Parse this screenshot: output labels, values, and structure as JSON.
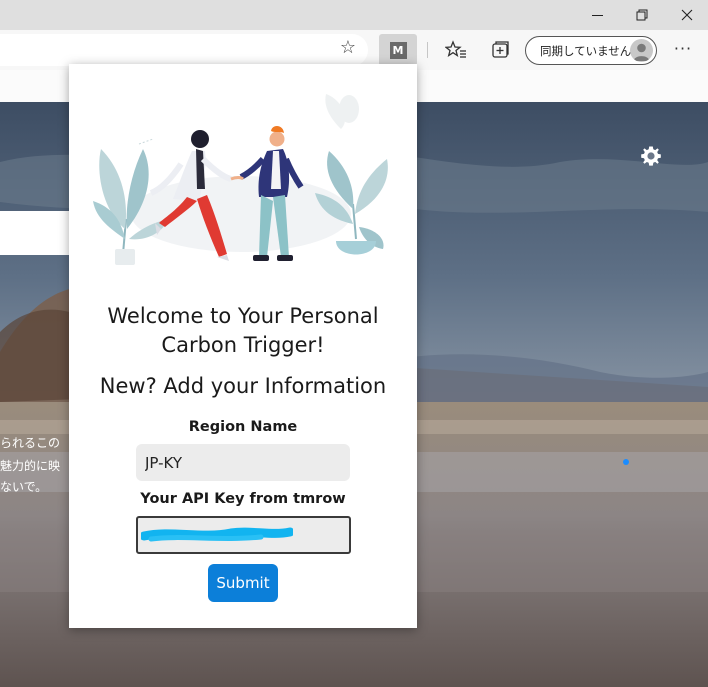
{
  "browser": {
    "sync_label": "同期していません",
    "extension_label": "M",
    "favorite_icon": "star-outline-icon",
    "more_label": "···"
  },
  "background_page": {
    "side_text": [
      "られるこの",
      "魅力的に映",
      "ないで。"
    ]
  },
  "popup": {
    "welcome_line1": "Welcome to Your Personal",
    "welcome_line2": "Carbon Trigger!",
    "subheading": "New? Add your Information",
    "region_label": "Region Name",
    "region_value": "JP-KY",
    "api_label": "Your API Key from tmrow",
    "api_value": "",
    "submit_label": "Submit"
  },
  "colors": {
    "submit": "#0c7fd9",
    "scribble": "#12b4f0",
    "titlebar": "#dfdfdf"
  }
}
